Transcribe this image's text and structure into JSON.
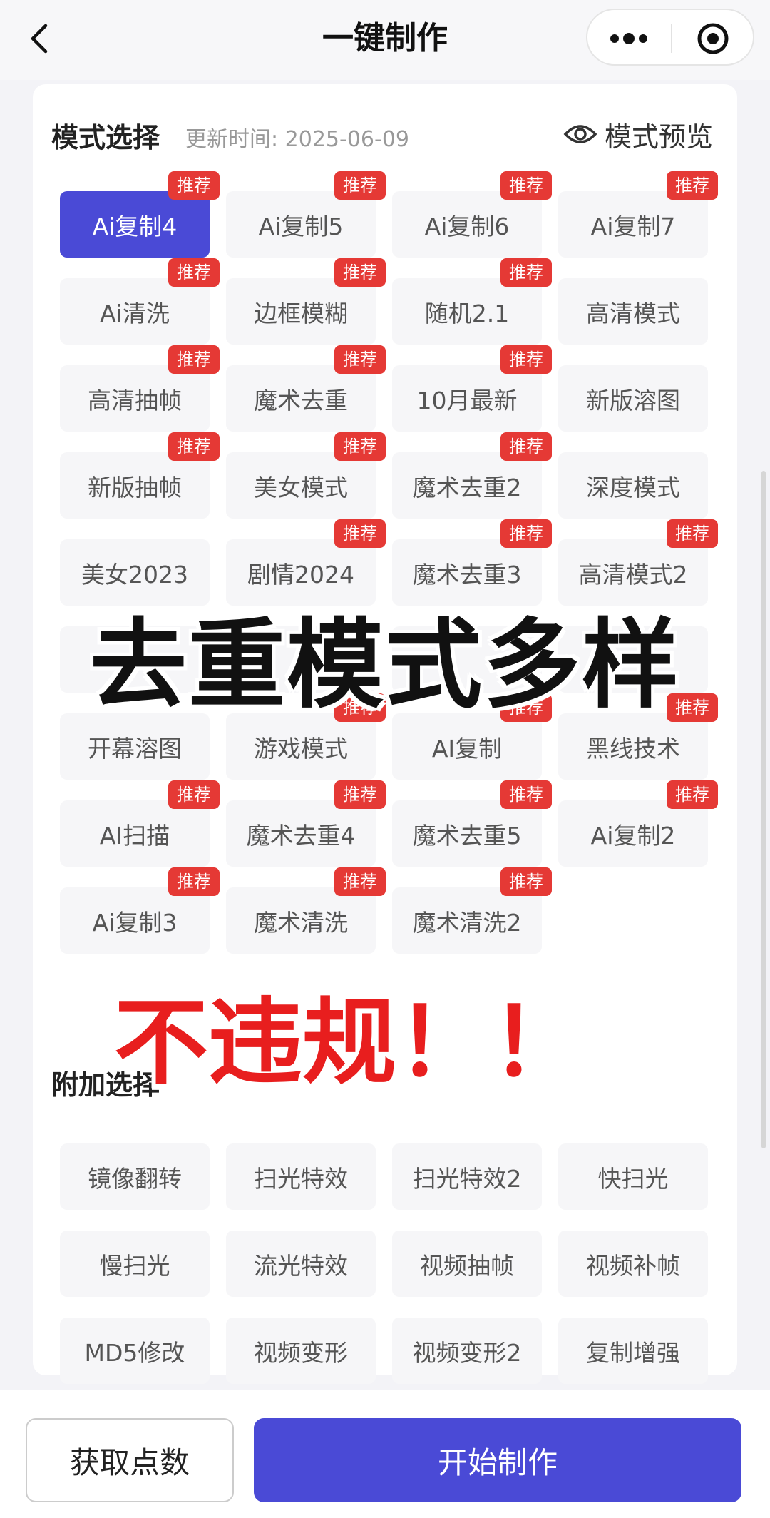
{
  "header": {
    "title": "一键制作",
    "back_icon": "chevron-left-icon",
    "more_icon": "more-dots-icon",
    "target_icon": "target-icon"
  },
  "mode_section": {
    "title": "模式选择",
    "update_time": "更新时间: 2025-06-09",
    "preview_label": "模式预览",
    "preview_icon": "eye-icon",
    "badge_label": "推荐",
    "modes": [
      {
        "label": "Ai复制4",
        "badge": "推荐",
        "selected": true
      },
      {
        "label": "Ai复制5",
        "badge": "推荐"
      },
      {
        "label": "Ai复制6",
        "badge": "推荐"
      },
      {
        "label": "Ai复制7",
        "badge": "推荐"
      },
      {
        "label": "Ai清洗",
        "badge": "推荐"
      },
      {
        "label": "边框模糊",
        "badge": "推荐"
      },
      {
        "label": "随机2.1",
        "badge": "推荐"
      },
      {
        "label": "高清模式",
        "badge": ""
      },
      {
        "label": "高清抽帧",
        "badge": "推荐"
      },
      {
        "label": "魔术去重",
        "badge": "推荐"
      },
      {
        "label": "10月最新",
        "badge": "推荐"
      },
      {
        "label": "新版溶图",
        "badge": ""
      },
      {
        "label": "新版抽帧",
        "badge": "推荐"
      },
      {
        "label": "美女模式",
        "badge": "推荐"
      },
      {
        "label": "魔术去重2",
        "badge": "推荐"
      },
      {
        "label": "深度模式",
        "badge": ""
      },
      {
        "label": "美女2023",
        "badge": ""
      },
      {
        "label": "剧情2024",
        "badge": "推荐"
      },
      {
        "label": "魔术去重3",
        "badge": "推荐"
      },
      {
        "label": "高清模式2",
        "badge": "推荐"
      },
      {
        "label": "",
        "badge": ""
      },
      {
        "label": "",
        "badge": ""
      },
      {
        "label": "",
        "badge": ""
      },
      {
        "label": "",
        "badge": ""
      },
      {
        "label": "开幕溶图",
        "badge": ""
      },
      {
        "label": "游戏模式",
        "badge": "推荐"
      },
      {
        "label": "AI复制",
        "badge": "推荐"
      },
      {
        "label": "黑线技术",
        "badge": "推荐"
      },
      {
        "label": "AI扫描",
        "badge": "推荐"
      },
      {
        "label": "魔术去重4",
        "badge": "推荐"
      },
      {
        "label": "魔术去重5",
        "badge": "推荐"
      },
      {
        "label": "Ai复制2",
        "badge": "推荐"
      },
      {
        "label": "Ai复制3",
        "badge": "推荐"
      },
      {
        "label": "魔术清洗",
        "badge": "推荐"
      },
      {
        "label": "魔术清洗2",
        "badge": "推荐"
      }
    ]
  },
  "extra_section": {
    "title": "附加选择",
    "options": [
      "镜像翻转",
      "扫光特效",
      "扫光特效2",
      "快扫光",
      "慢扫光",
      "流光特效",
      "视频抽帧",
      "视频补帧",
      "MD5修改",
      "视频变形",
      "视频变形2",
      "复制增强"
    ]
  },
  "overlay": {
    "headline": "去重模式多样",
    "subline": "不违规！！"
  },
  "footer": {
    "points_label": "获取点数",
    "start_label": "开始制作"
  },
  "colors": {
    "primary": "#4a4ad6",
    "badge": "#e53935",
    "overlay_red": "#e81e1e"
  }
}
